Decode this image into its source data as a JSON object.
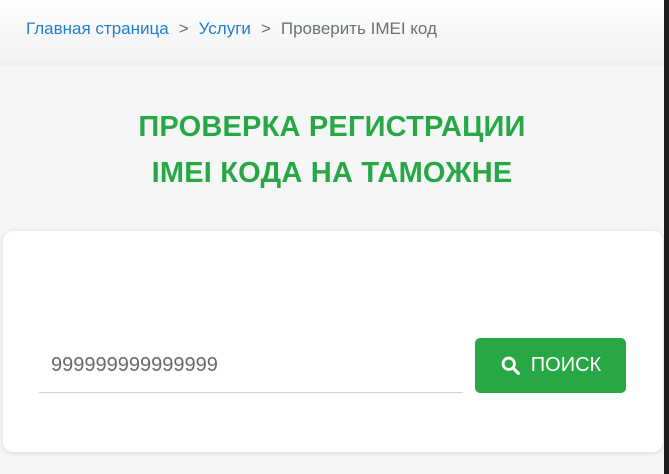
{
  "breadcrumb": {
    "home": "Главная страница",
    "services": "Услуги",
    "current": "Проверить IMEI код",
    "separator": ">"
  },
  "title": {
    "line1": "ПРОВЕРКА РЕГИСТРАЦИИ",
    "line2": "IMEI КОДА НА ТАМОЖНЕ"
  },
  "search": {
    "input_value": "999999999999999",
    "button_label": "ПОИСК",
    "button_icon": "search-icon"
  },
  "colors": {
    "accent": "#28a745",
    "link": "#1f7fd0"
  }
}
